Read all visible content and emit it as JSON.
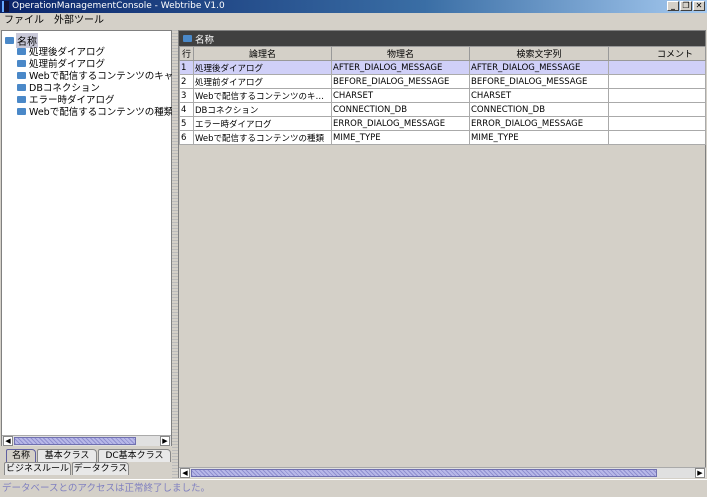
{
  "window": {
    "title": "OperationManagementConsole - Webtribe V1.0",
    "controls": [
      "_",
      "❐",
      "✕"
    ]
  },
  "menu": [
    "ファイル",
    "外部ツール"
  ],
  "tree": {
    "root": "名称",
    "items": [
      "処理後ダイアログ",
      "処理前ダイアログ",
      "Webで配信するコンテンツのキャラク",
      "DBコネクション",
      "エラー時ダイアログ",
      "Webで配信するコンテンツの種類"
    ]
  },
  "tabs": {
    "row1": [
      "名称",
      "基本クラス",
      "DC基本クラス"
    ],
    "row2": [
      "ビジネスルール",
      "データクラス"
    ],
    "selected": "名称"
  },
  "table": {
    "title": "名称",
    "columns": [
      "行",
      "論理名",
      "物理名",
      "検索文字列",
      "コメント"
    ],
    "rows": [
      [
        "1",
        "処理後ダイアログ",
        "AFTER_DIALOG_MESSAGE",
        "AFTER_DIALOG_MESSAGE",
        ""
      ],
      [
        "2",
        "処理前ダイアログ",
        "BEFORE_DIALOG_MESSAGE",
        "BEFORE_DIALOG_MESSAGE",
        ""
      ],
      [
        "3",
        "Webで配信するコンテンツのキャ…",
        "CHARSET",
        "CHARSET",
        ""
      ],
      [
        "4",
        "DBコネクション",
        "CONNECTION_DB",
        "CONNECTION_DB",
        ""
      ],
      [
        "5",
        "エラー時ダイアログ",
        "ERROR_DIALOG_MESSAGE",
        "ERROR_DIALOG_MESSAGE",
        ""
      ],
      [
        "6",
        "Webで配信するコンテンツの種類",
        "MIME_TYPE",
        "MIME_TYPE",
        ""
      ]
    ],
    "selected_row": 1
  },
  "status": "データベースとのアクセスは正常終了しました。"
}
